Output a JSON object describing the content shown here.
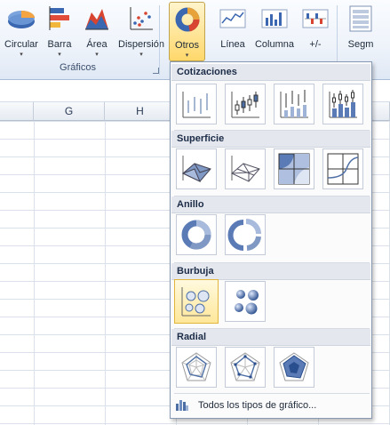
{
  "ribbon": {
    "buttons": [
      {
        "label": "Circular",
        "icon": "pie-chart-icon"
      },
      {
        "label": "Barra",
        "icon": "bar-chart-icon"
      },
      {
        "label": "Área",
        "icon": "area-chart-icon"
      },
      {
        "label": "Dispersión",
        "icon": "scatter-chart-icon"
      },
      {
        "label": "Otros",
        "icon": "doughnut-chart-icon"
      }
    ],
    "group_label": "Gráficos",
    "sparklines": [
      {
        "label": "Línea",
        "icon": "sparkline-line-icon"
      },
      {
        "label": "Columna",
        "icon": "sparkline-column-icon"
      },
      {
        "label": "+/-",
        "icon": "sparkline-winloss-icon"
      }
    ],
    "slicer_label": "Segm"
  },
  "sheet": {
    "columns": [
      "G",
      "H"
    ]
  },
  "dropdown": {
    "sections": [
      {
        "title": "Cotizaciones",
        "tiles": [
          "stock-hlc-icon",
          "stock-ohlc-icon",
          "stock-vhlc-icon",
          "stock-vohlc-icon"
        ]
      },
      {
        "title": "Superficie",
        "tiles": [
          "surface-3d-icon",
          "surface-wireframe-3d-icon",
          "contour-icon",
          "contour-wireframe-icon"
        ]
      },
      {
        "title": "Anillo",
        "tiles": [
          "doughnut-icon",
          "exploded-doughnut-icon"
        ]
      },
      {
        "title": "Burbuja",
        "tiles": [
          "bubble-icon",
          "bubble-3d-icon"
        ],
        "selected_index": 0
      },
      {
        "title": "Radial",
        "tiles": [
          "radar-icon",
          "radar-markers-icon",
          "filled-radar-icon"
        ]
      }
    ],
    "footer_label": "Todos los tipos de gráfico..."
  },
  "colors": {
    "accent": "#4e6fa5",
    "selected": "#ffe79a",
    "header_bg": "#e4e8ee"
  }
}
